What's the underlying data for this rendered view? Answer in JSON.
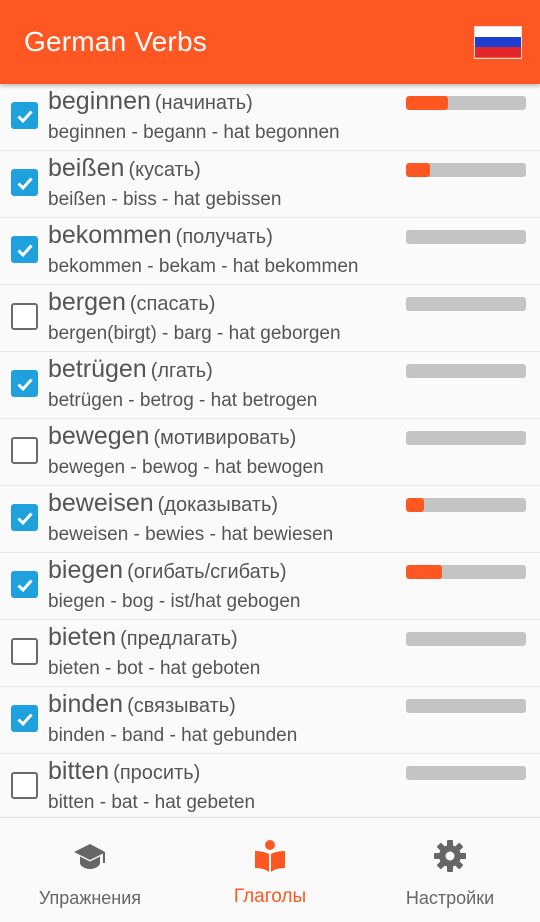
{
  "app": {
    "title": "German Verbs",
    "accent_color": "#ff5722",
    "flag": {
      "name": "russian-flag-icon",
      "colors": [
        "#ffffff",
        "#1c3fd0",
        "#e3262b"
      ]
    }
  },
  "verbs": [
    {
      "verb": "beginnen",
      "translation": "(начинать)",
      "forms": "beginnen - begann - hat begonnen",
      "checked": true,
      "progress": 0.35
    },
    {
      "verb": "beißen",
      "translation": "(кусать)",
      "forms": "beißen - biss - hat gebissen",
      "checked": true,
      "progress": 0.2
    },
    {
      "verb": "bekommen",
      "translation": "(получать)",
      "forms": "bekommen - bekam - hat bekommen",
      "checked": true,
      "progress": 0
    },
    {
      "verb": "bergen",
      "translation": "(спасать)",
      "forms": "bergen(birgt) - barg - hat geborgen",
      "checked": false,
      "progress": 0
    },
    {
      "verb": "betrügen",
      "translation": "(лгать)",
      "forms": "betrügen - betrog - hat betrogen",
      "checked": true,
      "progress": 0
    },
    {
      "verb": "bewegen",
      "translation": "(мотивировать)",
      "forms": "bewegen - bewog - hat bewogen",
      "checked": false,
      "progress": 0
    },
    {
      "verb": "beweisen",
      "translation": "(доказывать)",
      "forms": "beweisen - bewies - hat bewiesen",
      "checked": true,
      "progress": 0.15
    },
    {
      "verb": "biegen",
      "translation": "(огибать/сгибать)",
      "forms": "biegen - bog - ist/hat gebogen",
      "checked": true,
      "progress": 0.3
    },
    {
      "verb": "bieten",
      "translation": "(предлагать)",
      "forms": "bieten - bot - hat geboten",
      "checked": false,
      "progress": 0
    },
    {
      "verb": "binden",
      "translation": "(связывать)",
      "forms": "binden - band - hat gebunden",
      "checked": true,
      "progress": 0
    },
    {
      "verb": "bitten",
      "translation": "(просить)",
      "forms": "bitten - bat - hat gebeten",
      "checked": false,
      "progress": 0
    }
  ],
  "bottom_nav": [
    {
      "label": "Упражнения",
      "icon": "graduation-cap-icon",
      "active": false
    },
    {
      "label": "Глаголы",
      "icon": "book-reader-icon",
      "active": true
    },
    {
      "label": "Настройки",
      "icon": "gear-icon",
      "active": false
    }
  ],
  "colors": {
    "checkbox_checked": "#1ea1dd",
    "progress_track": "#c4c4c4",
    "nav_inactive": "#666666"
  }
}
